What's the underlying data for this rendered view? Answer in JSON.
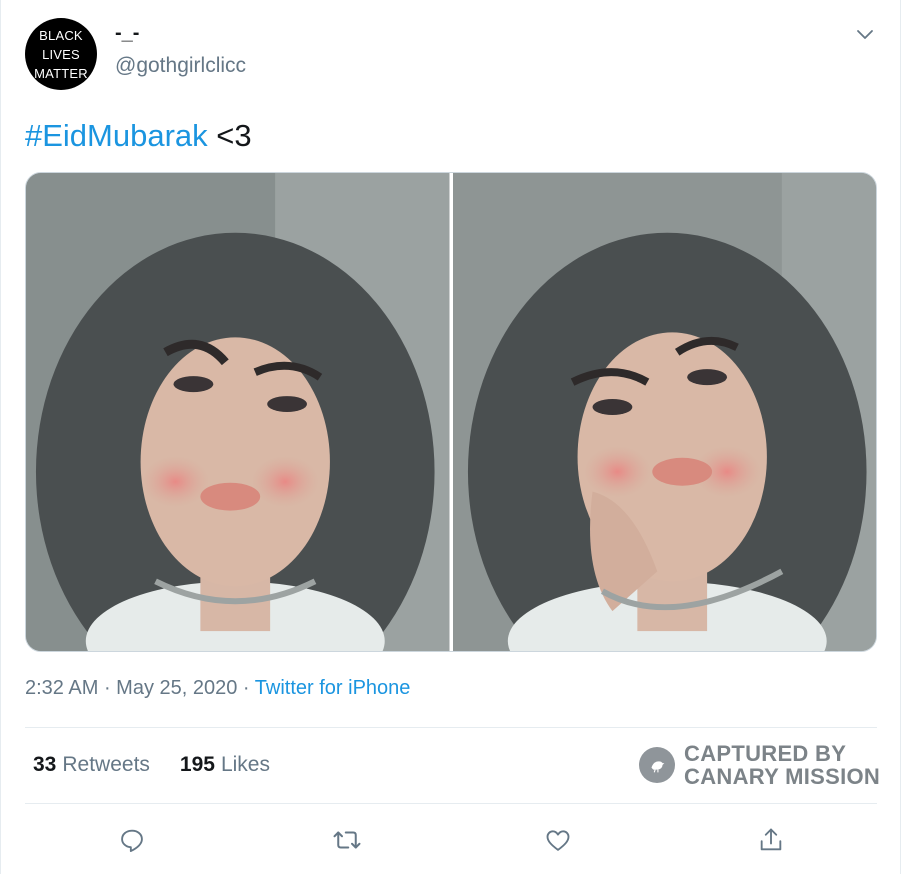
{
  "author": {
    "avatar_text": [
      "BLACK",
      "LIVES",
      "MATTER"
    ],
    "display_name": "-_-",
    "handle": "@gothgirlclicc"
  },
  "tweet": {
    "hashtag": "#EidMubarak",
    "text_rest": " <3"
  },
  "media": {
    "photos": [
      {
        "label": "selfie-photo-1"
      },
      {
        "label": "selfie-photo-2"
      }
    ]
  },
  "meta": {
    "time": "2:32 AM",
    "separator1": " · ",
    "date": "May 25, 2020",
    "separator2": " · ",
    "source": "Twitter for iPhone"
  },
  "stats": {
    "retweets_count": "33",
    "retweets_label": "Retweets",
    "likes_count": "195",
    "likes_label": "Likes"
  },
  "watermark": {
    "line1": "CAPTURED BY",
    "line2": "CANARY MISSION"
  },
  "actions": {
    "icons": [
      "reply-icon",
      "retweet-icon",
      "like-icon",
      "share-icon"
    ]
  },
  "colors": {
    "link": "#1b95e0",
    "secondary_text": "#657786",
    "primary_text": "#14171a",
    "border": "#e6ecf0"
  }
}
